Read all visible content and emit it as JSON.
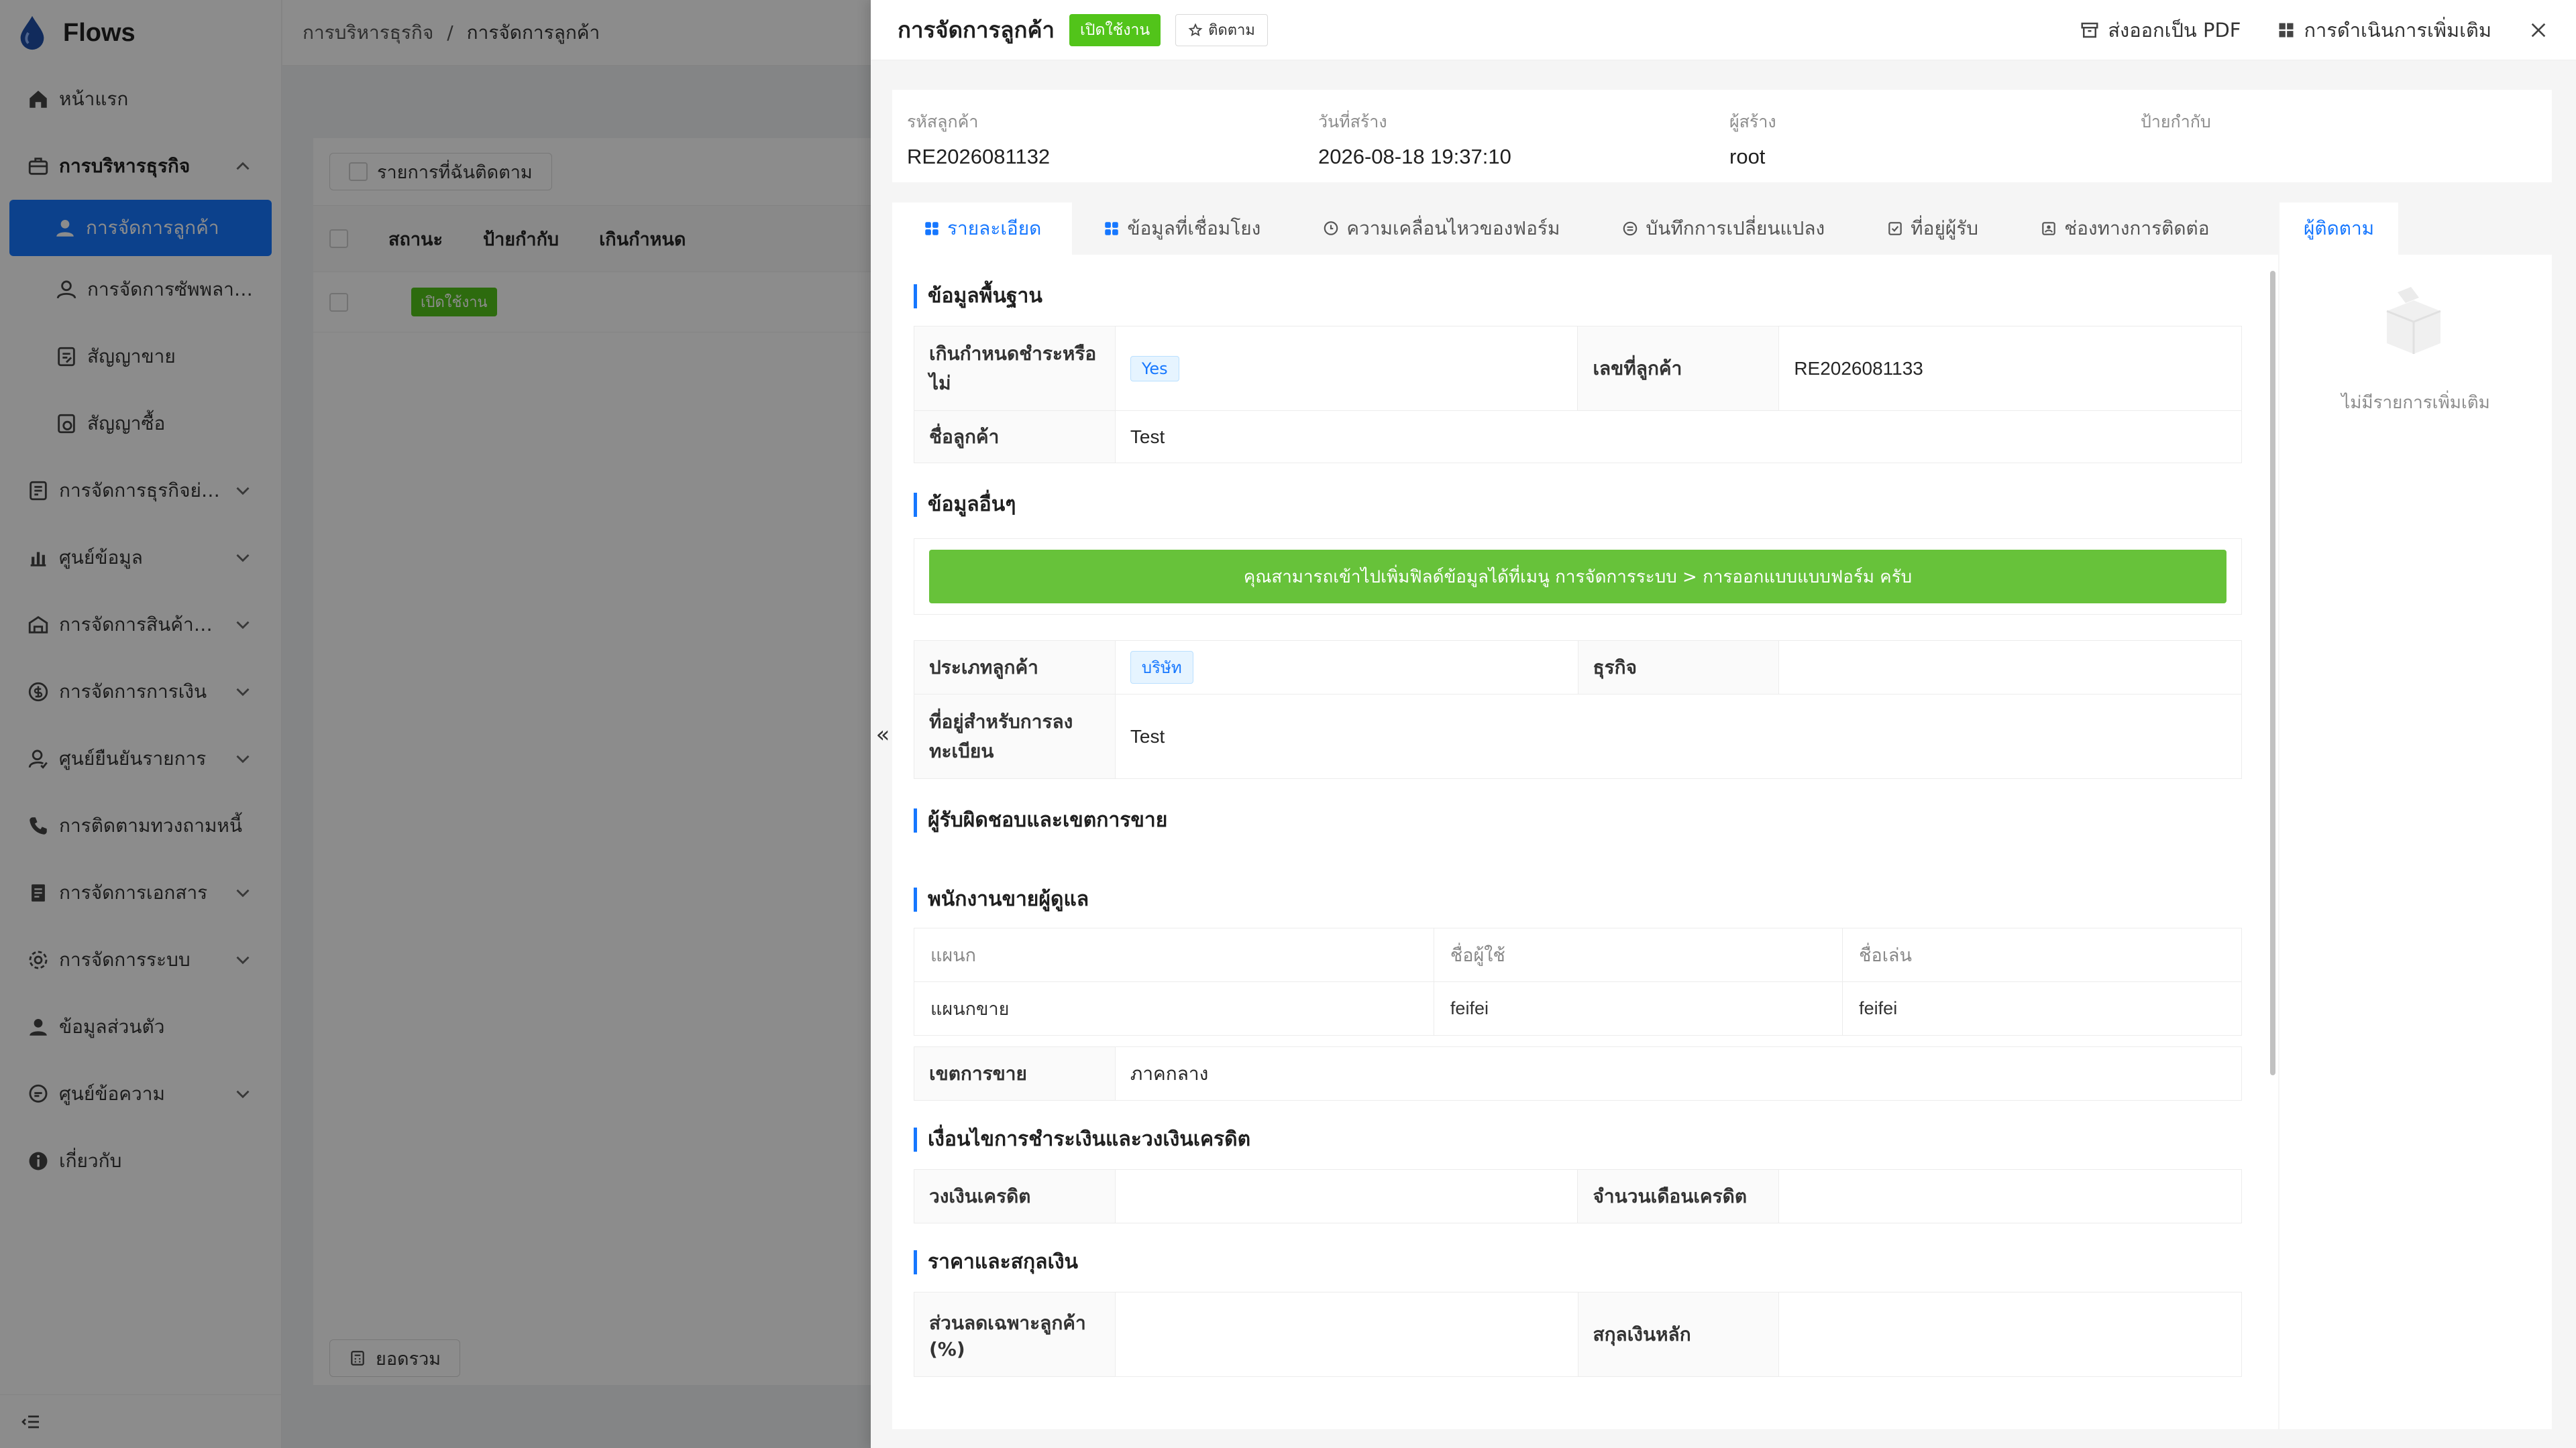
{
  "app": {
    "name": "Flows"
  },
  "sidebar": {
    "items": [
      {
        "label": "หน้าแรก",
        "icon": "home-icon"
      },
      {
        "label": "การบริหารธุรกิจ",
        "icon": "briefcase-icon"
      },
      {
        "label": "การจัดการลูกค้า",
        "icon": "user-icon"
      },
      {
        "label": "การจัดการซัพพลาย...",
        "icon": "user-outline-icon"
      },
      {
        "label": "สัญญาขาย",
        "icon": "contract-icon"
      },
      {
        "label": "สัญญาซื้อ",
        "icon": "contract-buy-icon"
      },
      {
        "label": "การจัดการธุรกิจย่อย",
        "icon": "sub-business-icon"
      },
      {
        "label": "ศูนย์ข้อมูล",
        "icon": "chart-icon"
      },
      {
        "label": "การจัดการสินค้าคง...",
        "icon": "warehouse-icon"
      },
      {
        "label": "การจัดการการเงิน",
        "icon": "money-icon"
      },
      {
        "label": "ศูนย์ยืนยันรายการ",
        "icon": "verify-icon"
      },
      {
        "label": "การติดตามทวงถามหนี้",
        "icon": "phone-icon"
      },
      {
        "label": "การจัดการเอกสาร",
        "icon": "document-icon"
      },
      {
        "label": "การจัดการระบบ",
        "icon": "settings-icon"
      },
      {
        "label": "ข้อมูลส่วนตัว",
        "icon": "profile-icon"
      },
      {
        "label": "ศูนย์ข้อความ",
        "icon": "message-icon"
      },
      {
        "label": "เกี่ยวกับ",
        "icon": "info-icon"
      }
    ]
  },
  "breadcrumb": {
    "parent": "การบริหารธุรกิจ",
    "separator": "/",
    "current": "การจัดการลูกค้า"
  },
  "list": {
    "followed_button": "รายการที่ฉันติดตาม",
    "columns": [
      "สถานะ",
      "ป้ายกำกับ",
      "เกินกำหนด"
    ],
    "row_status": "เปิดใช้งาน",
    "total_button": "ยอดรวม"
  },
  "drawer": {
    "title": "การจัดการลูกค้า",
    "status": "เปิดใช้งาน",
    "follow_label": "ติดตาม",
    "export_pdf": "ส่งออกเป็น PDF",
    "more_actions": "การดำเนินการเพิ่มเติม",
    "summary": [
      {
        "label": "รหัสลูกค้า",
        "value": "RE2026081132"
      },
      {
        "label": "วันที่สร้าง",
        "value": "2026-08-18 19:37:10"
      },
      {
        "label": "ผู้สร้าง",
        "value": "root"
      },
      {
        "label": "ป้ายกำกับ",
        "value": ""
      }
    ],
    "tabs": [
      {
        "label": "รายละเอียด",
        "icon": "grid-icon"
      },
      {
        "label": "ข้อมูลที่เชื่อมโยง",
        "icon": "grid-icon"
      },
      {
        "label": "ความเคลื่อนไหวของฟอร์ม",
        "icon": "chat-icon"
      },
      {
        "label": "บันทึกการเปลี่ยนแปลง",
        "icon": "record-icon"
      },
      {
        "label": "ที่อยู่ผู้รับ",
        "icon": "address-icon"
      },
      {
        "label": "ช่องทางการติดต่อ",
        "icon": "contact-icon"
      }
    ],
    "follower_tab": "ผู้ติดตาม",
    "empty_text": "ไม่มีรายการเพิ่มเติม",
    "collapse_glyph": "«",
    "sections": {
      "basic": {
        "title": "ข้อมูลพื้นฐาน",
        "overdue_label": "เกินกำหนดชำระหรือไม่",
        "overdue_value": "Yes",
        "customer_no_label": "เลขที่ลูกค้า",
        "customer_no_value": "RE2026081133",
        "name_label": "ชื่อลูกค้า",
        "name_value": "Test"
      },
      "other": {
        "title": "ข้อมูลอื่นๆ",
        "notice": "คุณสามารถเข้าไปเพิ่มฟิลด์ข้อมูลได้ที่เมนู การจัดการระบบ > การออกแบบแบบฟอร์ม ครับ",
        "type_label": "ประเภทลูกค้า",
        "type_value": "บริษัท",
        "business_label": "ธุรกิจ",
        "business_value": "",
        "reg_address_label": "ที่อยู่สำหรับการลงทะเบียน",
        "reg_address_value": "Test"
      },
      "responsible": {
        "title": "ผู้รับผิดชอบและเขตการขาย"
      },
      "sales_staff": {
        "title": "พนักงานขายผู้ดูแล",
        "headers": [
          "แผนก",
          "ชื่อผู้ใช้",
          "ชื่อเล่น"
        ],
        "rows": [
          [
            "แผนกขาย",
            "feifei",
            "feifei"
          ]
        ],
        "region_label": "เขตการขาย",
        "region_value": "ภาคกลาง"
      },
      "payment": {
        "title": "เงื่อนไขการชำระเงินและวงเงินเครดิต",
        "credit_limit_label": "วงเงินเครดิต",
        "credit_limit_value": "",
        "credit_months_label": "จำนวนเดือนเครดิต",
        "credit_months_value": ""
      },
      "price": {
        "title": "ราคาและสกุลเงิน",
        "discount_label": "ส่วนลดเฉพาะลูกค้า (%)",
        "discount_value": "",
        "currency_label": "สกุลเงินหลัก",
        "currency_value": ""
      }
    }
  }
}
